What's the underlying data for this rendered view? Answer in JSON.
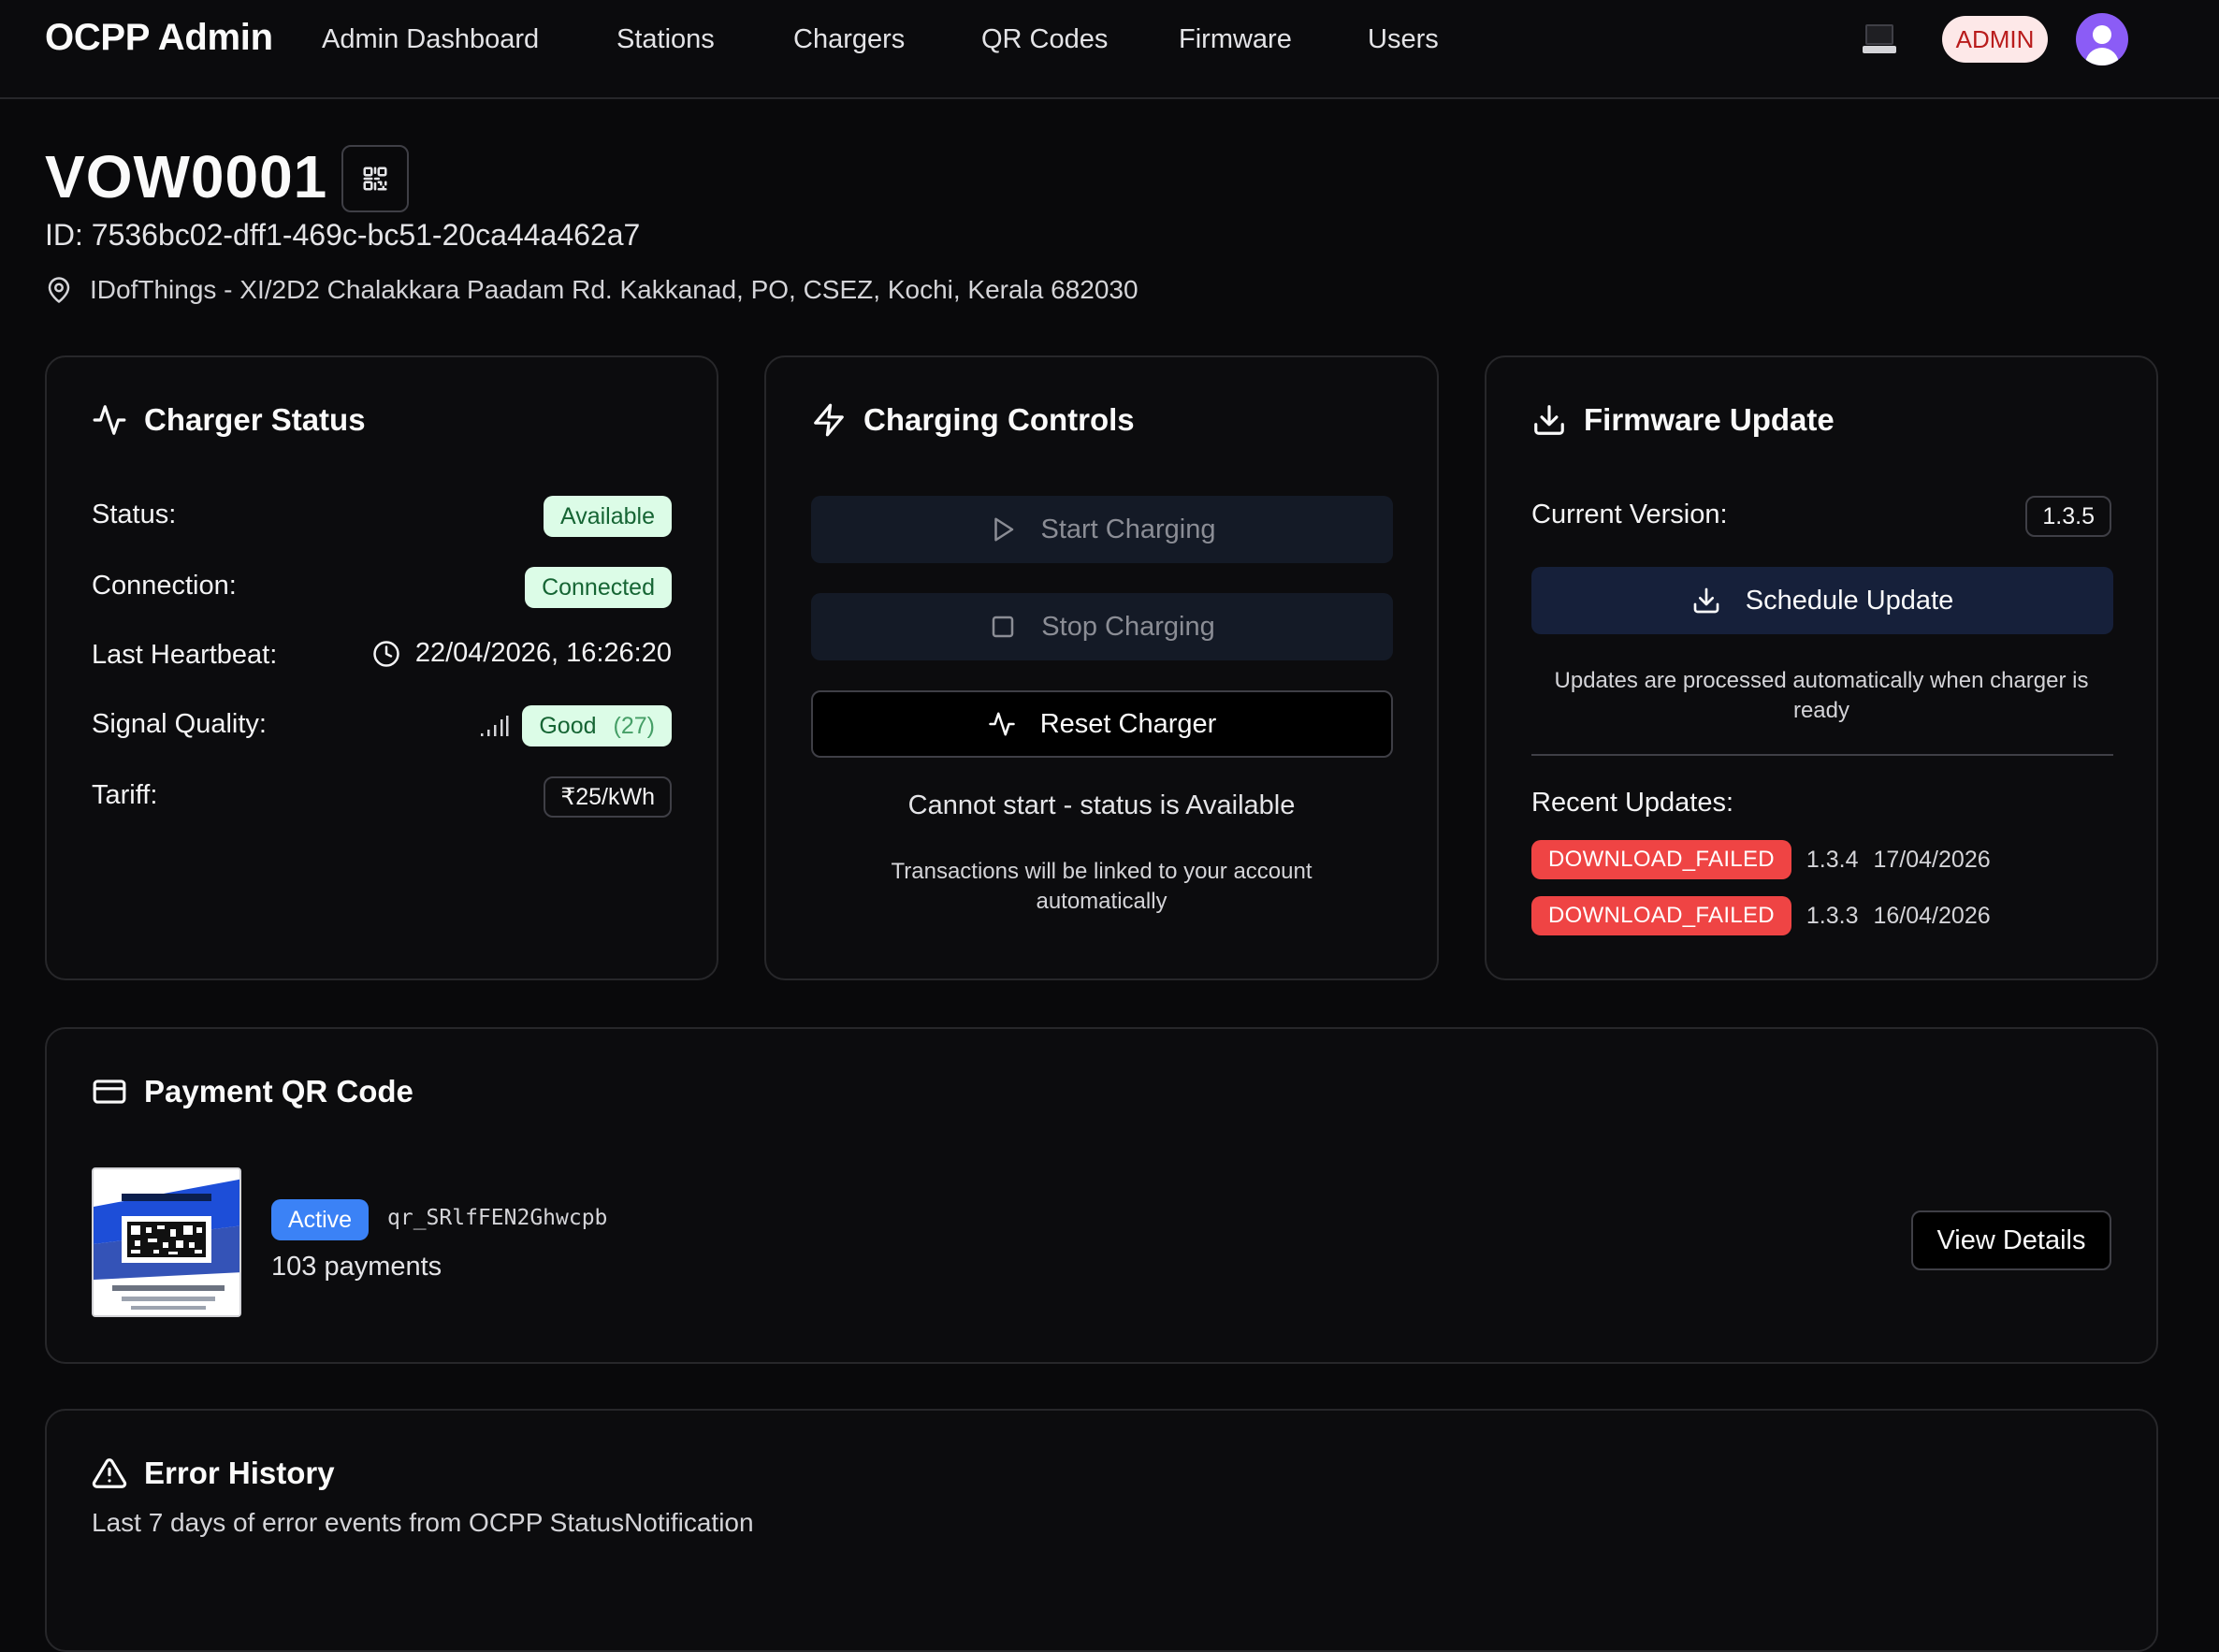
{
  "nav": {
    "brand": "OCPP Admin",
    "items": [
      "Admin Dashboard",
      "Stations",
      "Chargers",
      "QR Codes",
      "Firmware",
      "Users"
    ],
    "role_badge": "ADMIN"
  },
  "charger": {
    "name": "VOW0001",
    "id_line": "ID: 7536bc02-dff1-469c-bc51-20ca44a462a7",
    "address": "IDofThings - XI/2D2 Chalakkara Paadam Rd. Kakkanad, PO, CSEZ, Kochi, Kerala 682030"
  },
  "status_card": {
    "title": "Charger Status",
    "status_label": "Status:",
    "status_value": "Available",
    "connection_label": "Connection:",
    "connection_value": "Connected",
    "heartbeat_label": "Last Heartbeat:",
    "heartbeat_value": "22/04/2026, 16:26:20",
    "signal_label": "Signal Quality:",
    "signal_value": "Good",
    "signal_number": "(27)",
    "tariff_label": "Tariff:",
    "tariff_value": "₹25/kWh"
  },
  "controls_card": {
    "title": "Charging Controls",
    "start_label": "Start Charging",
    "stop_label": "Stop Charging",
    "reset_label": "Reset Charger",
    "status_message": "Cannot start - status is Available",
    "note": "Transactions will be linked to your account automatically"
  },
  "firmware_card": {
    "title": "Firmware Update",
    "current_label": "Current Version:",
    "current_value": "1.3.5",
    "schedule_label": "Schedule Update",
    "note": "Updates are processed automatically when charger is ready",
    "recent_label": "Recent Updates:",
    "updates": [
      {
        "status": "DOWNLOAD_FAILED",
        "version": "1.3.4",
        "date": "17/04/2026"
      },
      {
        "status": "DOWNLOAD_FAILED",
        "version": "1.3.3",
        "date": "16/04/2026"
      }
    ]
  },
  "payment_card": {
    "title": "Payment QR Code",
    "badge": "Active",
    "qr_id": "qr_SRlfFEN2Ghwcpb",
    "payments": "103 payments",
    "view_label": "View Details"
  },
  "error_card": {
    "title": "Error History",
    "subtitle": "Last 7 days of error events from OCPP StatusNotification"
  },
  "colors": {
    "background": "#09090b",
    "success_bg": "#dcfce7",
    "success_text": "#166534",
    "danger": "#ef4444",
    "accent_blue": "#3b82f6",
    "avatar": "#8b5cf6",
    "admin_badge_bg": "#fde8e8"
  }
}
